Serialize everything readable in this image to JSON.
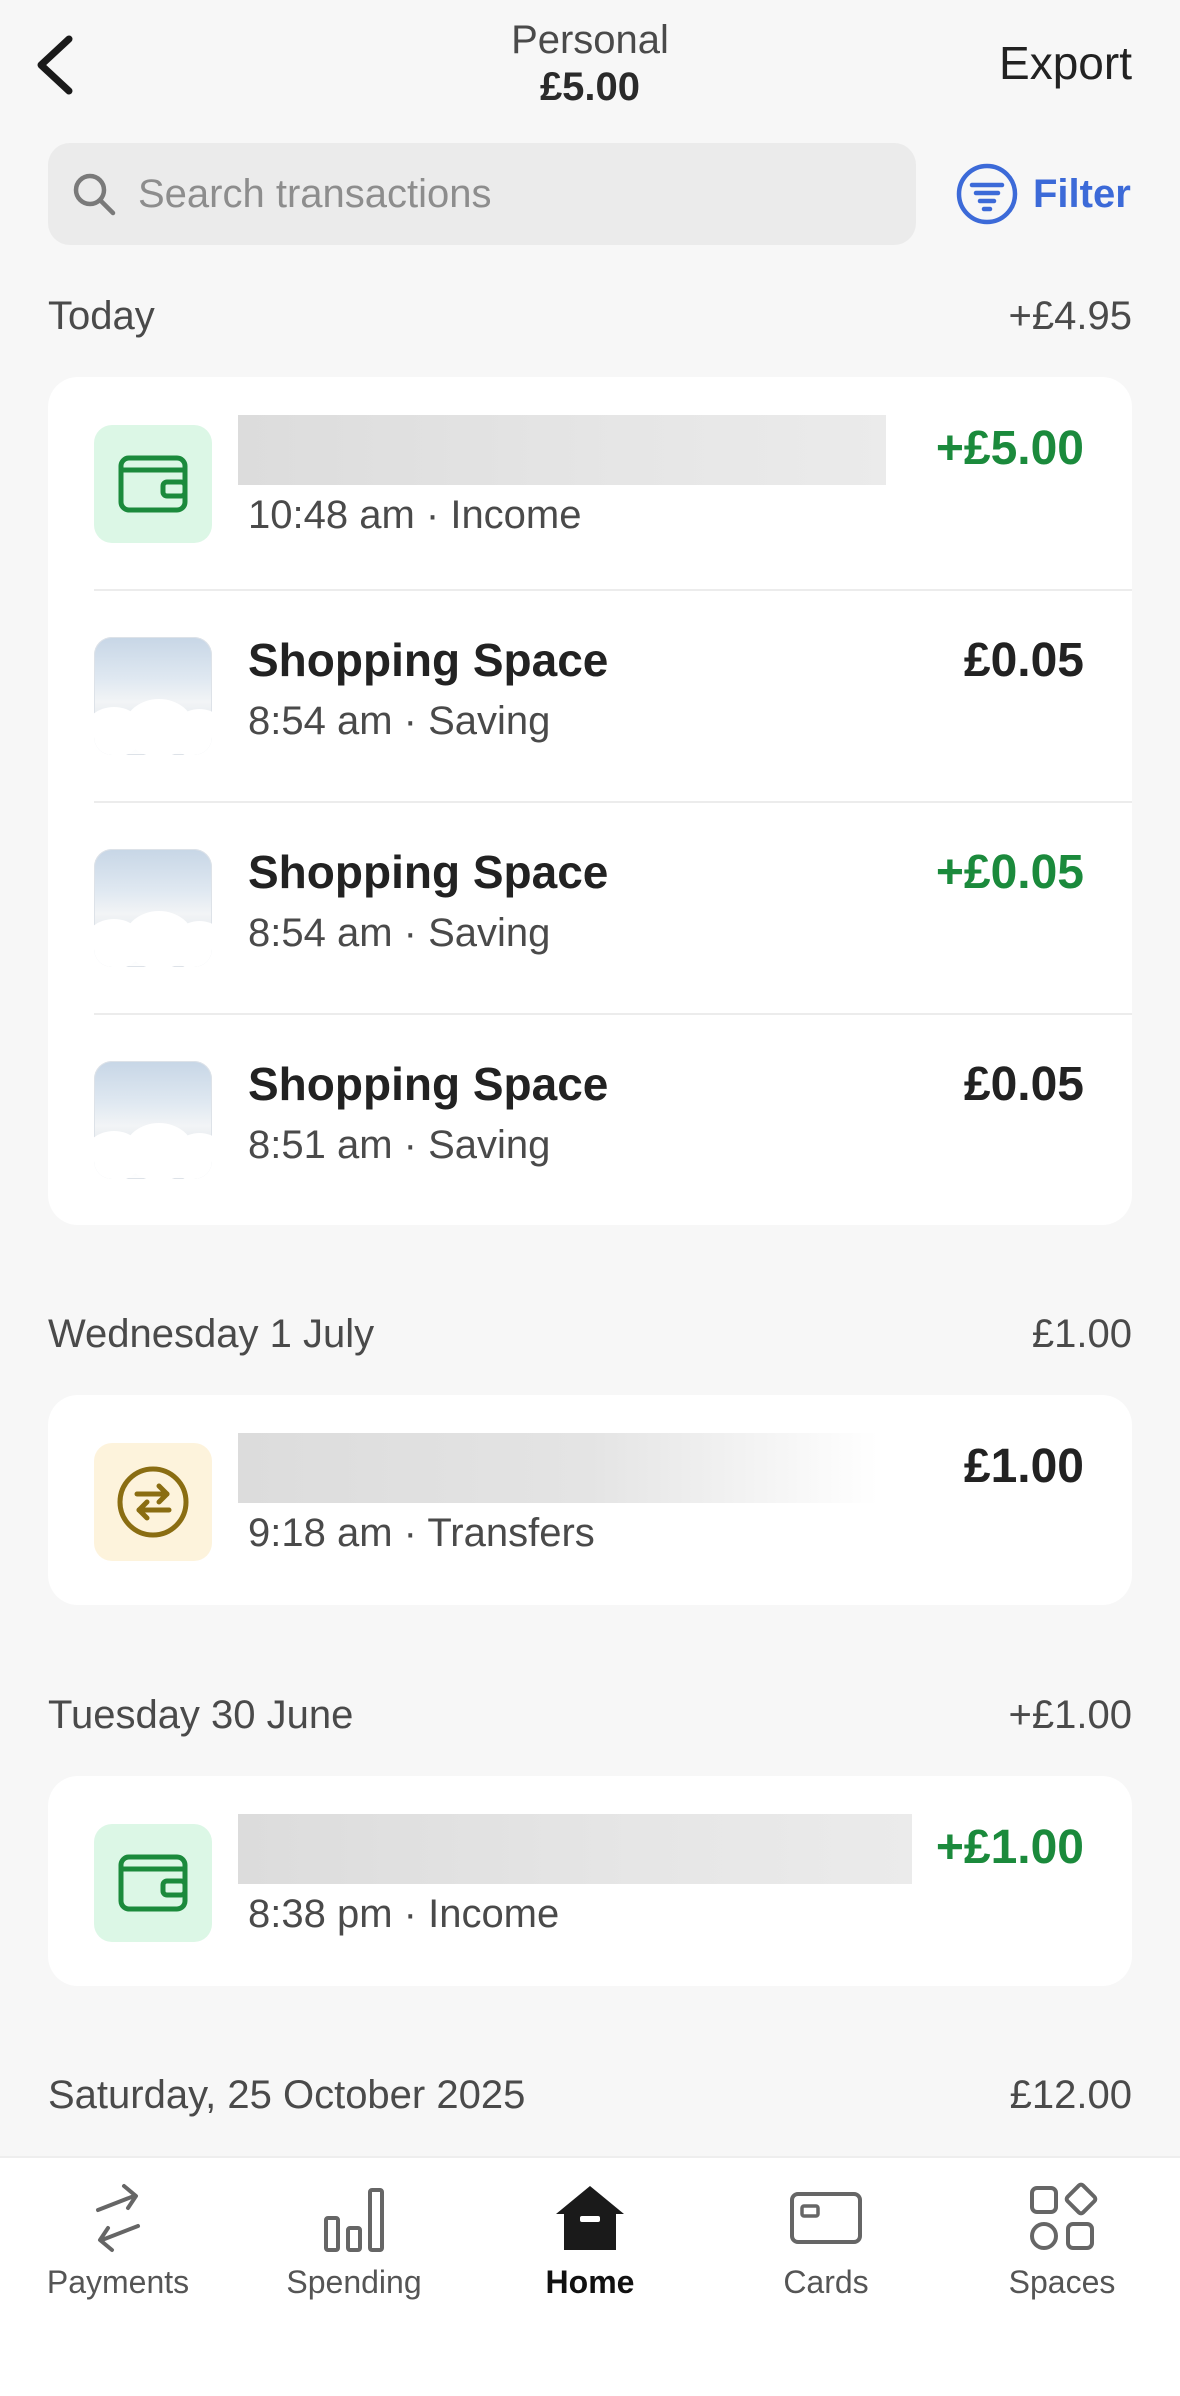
{
  "header": {
    "back_icon": "chevron-left-icon",
    "account_name": "Personal",
    "balance": "£5.00",
    "export_label": "Export"
  },
  "search": {
    "placeholder": "Search transactions",
    "filter_label": "Filter"
  },
  "colors": {
    "positive": "#1b8a3c",
    "accent": "#3c6ad8",
    "income_tile": "#dcf7e6",
    "transfer_tile": "#fdf3dc"
  },
  "groups": [
    {
      "date": "Today",
      "total": "+£4.95",
      "transactions": [
        {
          "icon": "wallet-icon",
          "title": "",
          "meta": "10:48 am · Income",
          "amount": "+£5.00",
          "positive": true
        },
        {
          "icon": "clouds-image",
          "title": "Shopping Space",
          "meta": "8:54 am · Saving",
          "amount": "£0.05",
          "positive": false
        },
        {
          "icon": "clouds-image",
          "title": "Shopping Space",
          "meta": "8:54 am · Saving",
          "amount": "+£0.05",
          "positive": true
        },
        {
          "icon": "clouds-image",
          "title": "Shopping Space",
          "meta": "8:51 am · Saving",
          "amount": "£0.05",
          "positive": false
        }
      ]
    },
    {
      "date": "Wednesday 1 July",
      "total": "£1.00",
      "transactions": [
        {
          "icon": "transfer-icon",
          "title": "",
          "meta": "9:18 am · Transfers",
          "amount": "£1.00",
          "positive": false
        }
      ]
    },
    {
      "date": "Tuesday 30 June",
      "total": "+£1.00",
      "transactions": [
        {
          "icon": "wallet-icon",
          "title": "",
          "meta": "8:38 pm · Income",
          "amount": "+£1.00",
          "positive": true
        }
      ]
    },
    {
      "date": "Saturday, 25 October 2025",
      "total": "£12.00",
      "transactions": []
    }
  ],
  "nav": [
    {
      "label": "Payments",
      "icon": "payments-arrows-icon",
      "active": false
    },
    {
      "label": "Spending",
      "icon": "bar-chart-icon",
      "active": false
    },
    {
      "label": "Home",
      "icon": "home-icon",
      "active": true
    },
    {
      "label": "Cards",
      "icon": "card-icon",
      "active": false
    },
    {
      "label": "Spaces",
      "icon": "spaces-grid-icon",
      "active": false
    }
  ]
}
